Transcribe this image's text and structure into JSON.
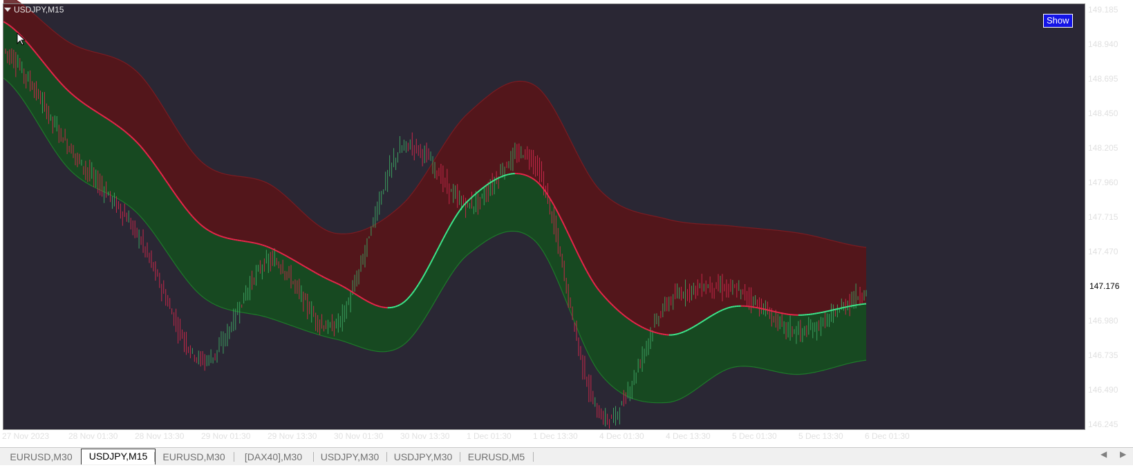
{
  "chart_label": "USDJPY,M15",
  "show_button": "Show",
  "current_price": "147.176",
  "price_ticks": [
    "149.185",
    "148.940",
    "148.695",
    "148.450",
    "148.205",
    "147.960",
    "147.715",
    "147.470",
    "147.225",
    "146.980",
    "146.735",
    "146.490",
    "146.245"
  ],
  "time_ticks": [
    "27 Nov 2023",
    "28 Nov 01:30",
    "28 Nov 13:30",
    "29 Nov 01:30",
    "29 Nov 13:30",
    "30 Nov 01:30",
    "30 Nov 13:30",
    "1 Dec 01:30",
    "1 Dec 13:30",
    "4 Dec 01:30",
    "4 Dec 13:30",
    "5 Dec 01:30",
    "5 Dec 13:30",
    "6 Dec 01:30"
  ],
  "tabs": [
    {
      "label": "EURUSD,M30",
      "active": false
    },
    {
      "label": "USDJPY,M15",
      "active": true
    },
    {
      "label": "EURUSD,M30",
      "active": false
    },
    {
      "label": "[DAX40],M30",
      "active": false
    },
    {
      "label": "USDJPY,M30",
      "active": false
    },
    {
      "label": "USDJPY,M30",
      "active": false
    },
    {
      "label": "EURUSD,M5",
      "active": false
    }
  ],
  "colors": {
    "background": "#2a2734",
    "upper_band": "#5a1418",
    "lower_band": "#14501e",
    "mid_down": "#e8254a",
    "mid_up": "#3ce88c",
    "candle_up": "#3ca060",
    "candle_down": "#c8284a"
  },
  "chart_data": {
    "type": "line",
    "symbol": "USDJPY",
    "timeframe": "M15",
    "ylim": [
      146.17,
      149.21
    ],
    "x": [
      "27 Nov 2023",
      "28 Nov 01:30",
      "28 Nov 13:30",
      "29 Nov 01:30",
      "29 Nov 13:30",
      "30 Nov 01:30",
      "30 Nov 13:30",
      "1 Dec 01:30",
      "1 Dec 13:30",
      "4 Dec 01:30",
      "4 Dec 13:30",
      "5 Dec 01:30",
      "5 Dec 13:30",
      "6 Dec 01:30"
    ],
    "series": [
      {
        "values": [
          149.1,
          148.6,
          148.25,
          147.65,
          147.5,
          147.25,
          147.1,
          147.83,
          147.98,
          147.18,
          146.88,
          147.08,
          147.02,
          147.1
        ]
      },
      {
        "values": [
          149.3,
          148.95,
          148.75,
          148.1,
          147.95,
          147.6,
          147.8,
          148.45,
          148.65,
          147.9,
          147.7,
          147.65,
          147.6,
          147.5
        ]
      },
      {
        "values": [
          148.7,
          148.05,
          147.75,
          147.15,
          147.0,
          146.85,
          146.8,
          147.45,
          147.55,
          146.6,
          146.4,
          146.65,
          146.6,
          146.7
        ]
      },
      {
        "values": [
          148.9,
          148.2,
          147.6,
          146.7,
          147.4,
          146.95,
          148.2,
          147.8,
          148.1,
          146.3,
          147.1,
          147.2,
          146.9,
          147.18
        ]
      }
    ]
  }
}
